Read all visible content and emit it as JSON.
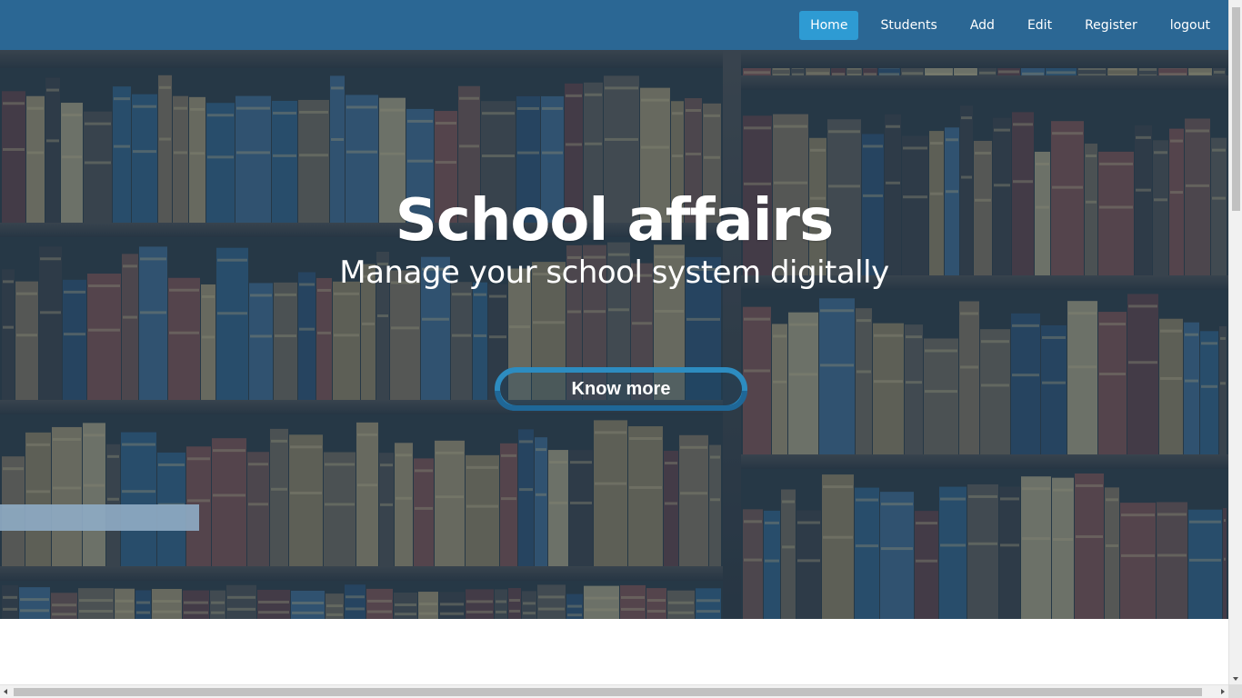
{
  "nav": {
    "items": [
      {
        "label": "Home",
        "active": true
      },
      {
        "label": "Students",
        "active": false
      },
      {
        "label": "Add",
        "active": false
      },
      {
        "label": "Edit",
        "active": false
      },
      {
        "label": "Register",
        "active": false
      },
      {
        "label": "logout",
        "active": false
      }
    ]
  },
  "hero": {
    "title": "School affairs",
    "subtitle": "Manage your school system digitally",
    "cta_label": "Know more",
    "background": "bookshelf-image"
  },
  "colors": {
    "navbar": "#2b6794",
    "nav_active": "#2e9bd3",
    "cta_border": "#2d8cc0",
    "overlay": "#1e507d"
  }
}
